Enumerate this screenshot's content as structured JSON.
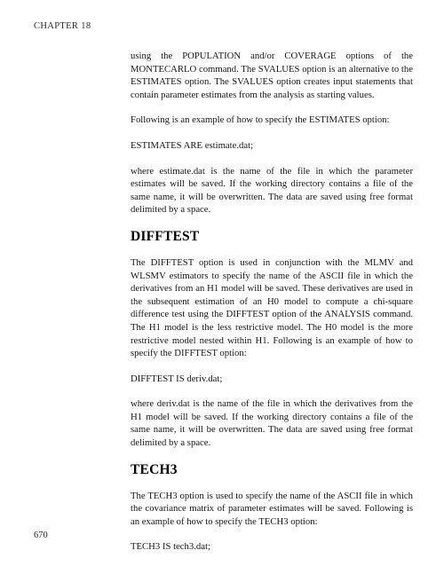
{
  "document": {
    "running_head": "CHAPTER 18",
    "page_number": "670"
  },
  "content": {
    "para_svalues": "using the POPULATION and/or COVERAGE options of the MONTECARLO command.  The SVALUES option is an alternative to the ESTIMATES option.  The SVALUES option creates input statements that contain parameter estimates from the analysis as starting values.",
    "para_estimates_intro": "Following is an example of how to specify the ESTIMATES option:",
    "code_estimates": "ESTIMATES ARE estimate.dat;",
    "para_estimates_where": "where estimate.dat is the name of the file in which the parameter estimates will be saved.  If the working directory contains a file of the same name, it will be overwritten.  The data are saved using free format delimited by a space.",
    "heading_difftest": "DIFFTEST",
    "para_difftest_body": "The DIFFTEST option is used in conjunction with the MLMV and WLSMV estimators to specify the name of the ASCII file in which the derivatives from an H1 model will be saved.  These derivatives are used in the subsequent estimation of an H0 model to compute a chi-square difference test using the DIFFTEST option of the ANALYSIS command.  The H1 model is the less restrictive model.  The H0 model is the more restrictive model nested within H1.  Following is an example of how to specify the DIFFTEST option:",
    "code_difftest": "DIFFTEST IS deriv.dat;",
    "para_difftest_where": "where deriv.dat is the name of the file in which the derivatives from the H1 model will be saved.  If the working directory contains a file of the same name, it will be overwritten.  The data are saved using free format delimited by a space.",
    "heading_tech3": "TECH3",
    "para_tech3_body": "The TECH3 option is used to specify the name of the ASCII file in which the covariance matrix of parameter estimates will be saved.  Following is an example of how to specify the TECH3 option:",
    "code_tech3": "TECH3 IS tech3.dat;"
  }
}
